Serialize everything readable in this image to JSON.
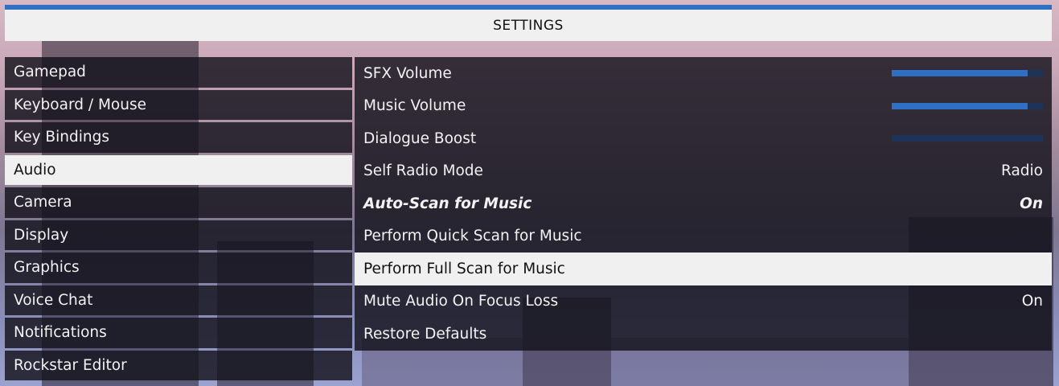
{
  "header": {
    "title": "SETTINGS",
    "accent_color": "#2f6fc4"
  },
  "categories": [
    {
      "label": "Gamepad",
      "selected": false
    },
    {
      "label": "Keyboard / Mouse",
      "selected": false
    },
    {
      "label": "Key Bindings",
      "selected": false
    },
    {
      "label": "Audio",
      "selected": true
    },
    {
      "label": "Camera",
      "selected": false
    },
    {
      "label": "Display",
      "selected": false
    },
    {
      "label": "Graphics",
      "selected": false
    },
    {
      "label": "Voice Chat",
      "selected": false
    },
    {
      "label": "Notifications",
      "selected": false
    },
    {
      "label": "Rockstar Editor",
      "selected": false
    }
  ],
  "options": [
    {
      "label": "SFX Volume",
      "type": "slider",
      "level": 0.9
    },
    {
      "label": "Music Volume",
      "type": "slider",
      "level": 0.9
    },
    {
      "label": "Dialogue Boost",
      "type": "slider",
      "level": 0.0
    },
    {
      "label": "Self Radio Mode",
      "type": "value",
      "value": "Radio"
    },
    {
      "label": "Auto-Scan for Music",
      "type": "value",
      "value": "On",
      "emphasis": "italic-bold"
    },
    {
      "label": "Perform Quick Scan for Music",
      "type": "action"
    },
    {
      "label": "Perform Full Scan for Music",
      "type": "action",
      "highlighted": true
    },
    {
      "label": "Mute Audio On Focus Loss",
      "type": "value",
      "value": "On"
    },
    {
      "label": "Restore Defaults",
      "type": "action"
    }
  ]
}
